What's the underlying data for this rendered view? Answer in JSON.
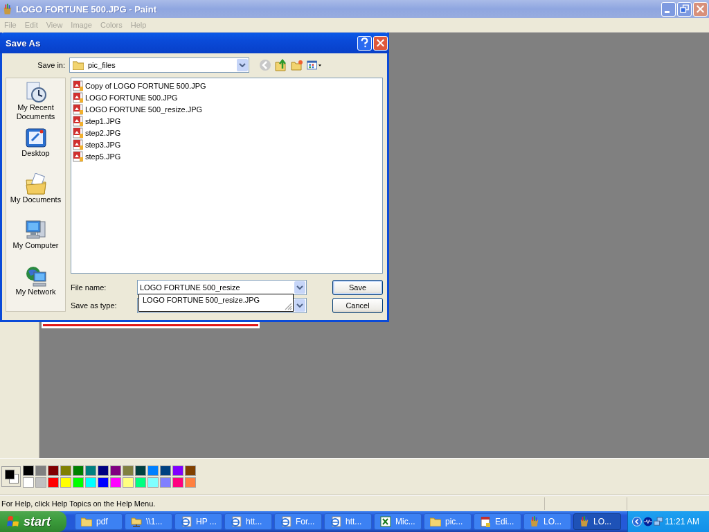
{
  "window": {
    "title": "LOGO FORTUNE 500.JPG - Paint"
  },
  "menu": [
    {
      "label": "File",
      "disabled": true
    },
    {
      "label": "Edit",
      "disabled": true
    },
    {
      "label": "View",
      "disabled": true
    },
    {
      "label": "Image",
      "disabled": true
    },
    {
      "label": "Colors",
      "disabled": true
    },
    {
      "label": "Help",
      "disabled": true
    }
  ],
  "dialog": {
    "title": "Save As",
    "save_in_label": "Save in:",
    "save_in": "pic_files",
    "places": [
      {
        "label": "My Recent Documents",
        "kind": "recent"
      },
      {
        "label": "Desktop",
        "kind": "desktop"
      },
      {
        "label": "My Documents",
        "kind": "documents"
      },
      {
        "label": "My Computer",
        "kind": "computer"
      },
      {
        "label": "My Network",
        "kind": "network"
      }
    ],
    "files": [
      "Copy of LOGO FORTUNE 500.JPG",
      "LOGO FORTUNE 500.JPG",
      "LOGO FORTUNE 500_resize.JPG",
      "step1.JPG",
      "step2.JPG",
      "step3.JPG",
      "step5.JPG"
    ],
    "file_name_label": "File name:",
    "file_name": "LOGO FORTUNE 500_resize",
    "suggestion": "LOGO FORTUNE 500_resize.JPG",
    "save_type_label": "Save as type:",
    "buttons": [
      {
        "label": "Save",
        "default": true
      },
      {
        "label": "Cancel",
        "default": false
      }
    ]
  },
  "palette": {
    "colors": [
      {
        "color": "#000000"
      },
      {
        "color": "#808080"
      },
      {
        "color": "#800000"
      },
      {
        "color": "#808000"
      },
      {
        "color": "#008000"
      },
      {
        "color": "#008080"
      },
      {
        "color": "#000080"
      },
      {
        "color": "#800080"
      },
      {
        "color": "#808040"
      },
      {
        "color": "#004040"
      },
      {
        "color": "#0080ff"
      },
      {
        "color": "#004080"
      },
      {
        "color": "#8000ff"
      },
      {
        "color": "#804000"
      },
      {
        "color": "#ffffff"
      },
      {
        "color": "#c0c0c0"
      },
      {
        "color": "#ff0000"
      },
      {
        "color": "#ffff00"
      },
      {
        "color": "#00ff00"
      },
      {
        "color": "#00ffff"
      },
      {
        "color": "#0000ff"
      },
      {
        "color": "#ff00ff"
      },
      {
        "color": "#ffff80"
      },
      {
        "color": "#00ff80"
      },
      {
        "color": "#80ffff"
      },
      {
        "color": "#8080ff"
      },
      {
        "color": "#ff0080"
      },
      {
        "color": "#ff8040"
      }
    ]
  },
  "status_bar": {
    "text": "For Help, click Help Topics on the Help Menu."
  },
  "taskbar": {
    "start": "start",
    "items": [
      {
        "label": "pdf",
        "kind": "folder",
        "selected": false
      },
      {
        "label": "\\\\1...",
        "kind": "netfolder",
        "selected": false
      },
      {
        "label": "HP ...",
        "kind": "ie",
        "selected": false
      },
      {
        "label": "htt...",
        "kind": "ie",
        "selected": false
      },
      {
        "label": "For...",
        "kind": "ie",
        "selected": false
      },
      {
        "label": "htt...",
        "kind": "ie",
        "selected": false
      },
      {
        "label": "Mic...",
        "kind": "excel",
        "selected": false
      },
      {
        "label": "pic...",
        "kind": "folder",
        "selected": false
      },
      {
        "label": "Edi...",
        "kind": "editor",
        "selected": false
      },
      {
        "label": "LO...",
        "kind": "paint",
        "selected": false
      },
      {
        "label": "LO...",
        "kind": "paint",
        "selected": true
      }
    ],
    "clock": "11:21 AM"
  }
}
